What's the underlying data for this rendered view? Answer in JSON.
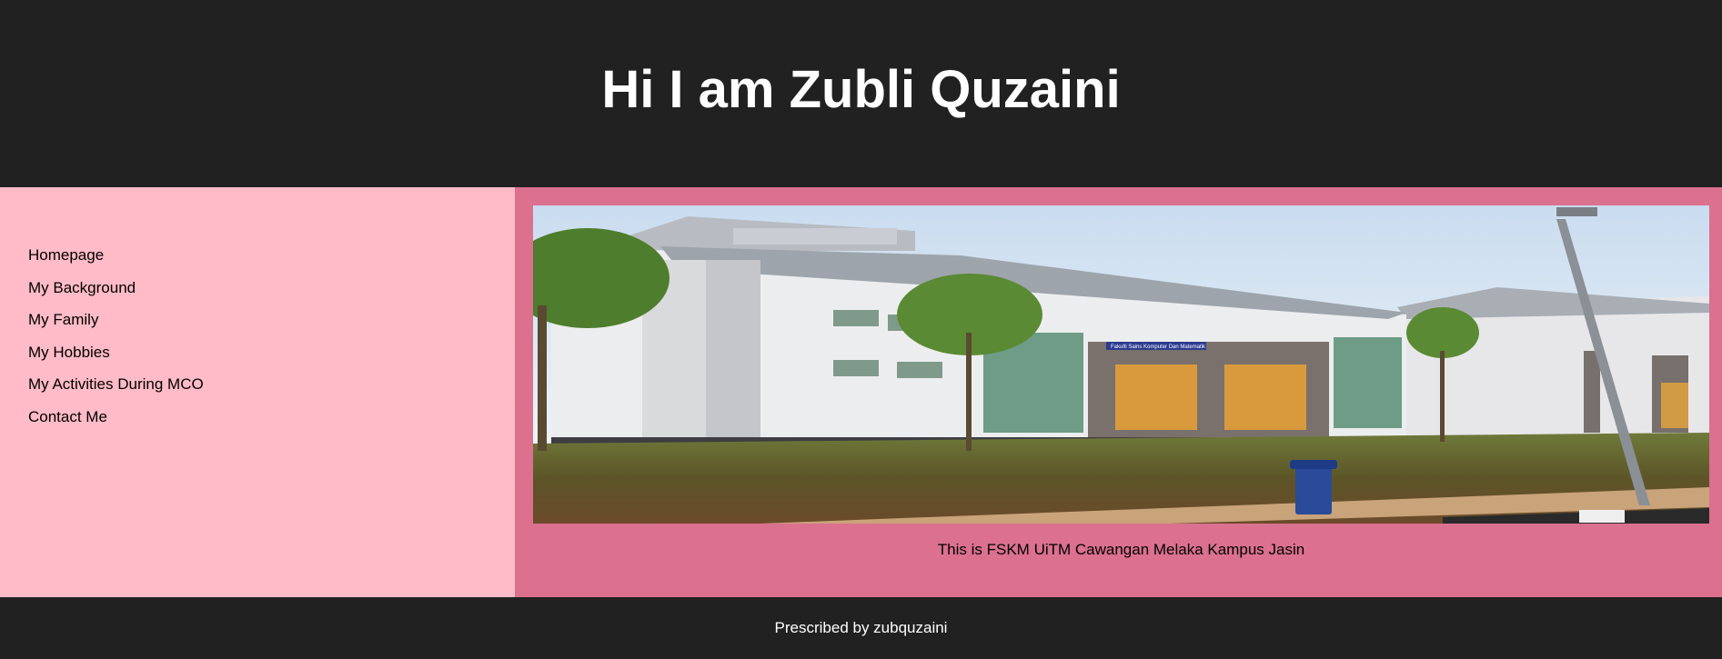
{
  "header": {
    "title": "Hi I am Zubli Quzaini"
  },
  "nav": {
    "items": [
      {
        "label": "Homepage"
      },
      {
        "label": "My Background"
      },
      {
        "label": "My Family"
      },
      {
        "label": "My Hobbies"
      },
      {
        "label": "My Activities During MCO"
      },
      {
        "label": "Contact Me"
      }
    ]
  },
  "main": {
    "image_sign": "Fakulti Sains Komputer Dan Matematik",
    "caption": "This is FSKM UiTM Cawangan Melaka Kampus Jasin"
  },
  "footer": {
    "text": "Prescribed by zubquzaini"
  },
  "colors": {
    "header_bg": "#212121",
    "sidebar_bg": "#ffbbc7",
    "main_bg": "#db708f",
    "footer_bg": "#212121",
    "title_text": "#ffffff"
  }
}
